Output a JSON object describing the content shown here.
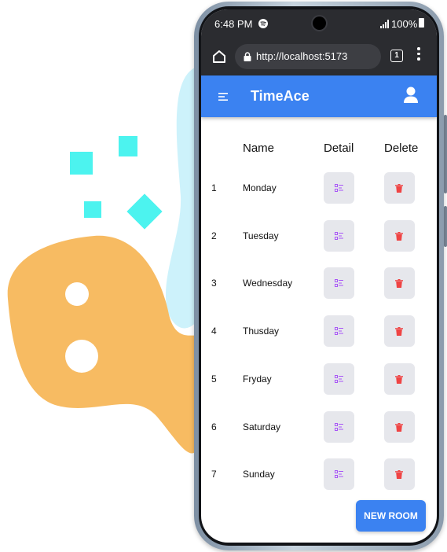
{
  "status_bar": {
    "time": "6:48 PM",
    "battery": "100%"
  },
  "browser": {
    "url": "http://localhost:5173",
    "tab_count": "1"
  },
  "app": {
    "title": "TimeAce"
  },
  "table": {
    "headers": {
      "name": "Name",
      "detail": "Detail",
      "delete": "Delete"
    },
    "rows": [
      {
        "index": "1",
        "name": "Monday"
      },
      {
        "index": "2",
        "name": "Tuesday"
      },
      {
        "index": "3",
        "name": "Wednesday"
      },
      {
        "index": "4",
        "name": "Thusday"
      },
      {
        "index": "5",
        "name": "Fryday"
      },
      {
        "index": "6",
        "name": "Saturday"
      },
      {
        "index": "7",
        "name": "Sunday"
      }
    ]
  },
  "actions": {
    "new_room": "NEW ROOM"
  },
  "icons": {
    "detail": "list-detail-icon",
    "delete": "trash-icon",
    "menu": "menu-icon",
    "user": "user-icon"
  },
  "colors": {
    "primary": "#3b82f1",
    "detail_icon": "#a855f7",
    "delete_icon": "#ef4444",
    "button_bg": "#e6e7ec",
    "blob_orange": "#f7bb62",
    "blob_blue": "#cdf2fb",
    "squares": "#4cf3ef"
  }
}
